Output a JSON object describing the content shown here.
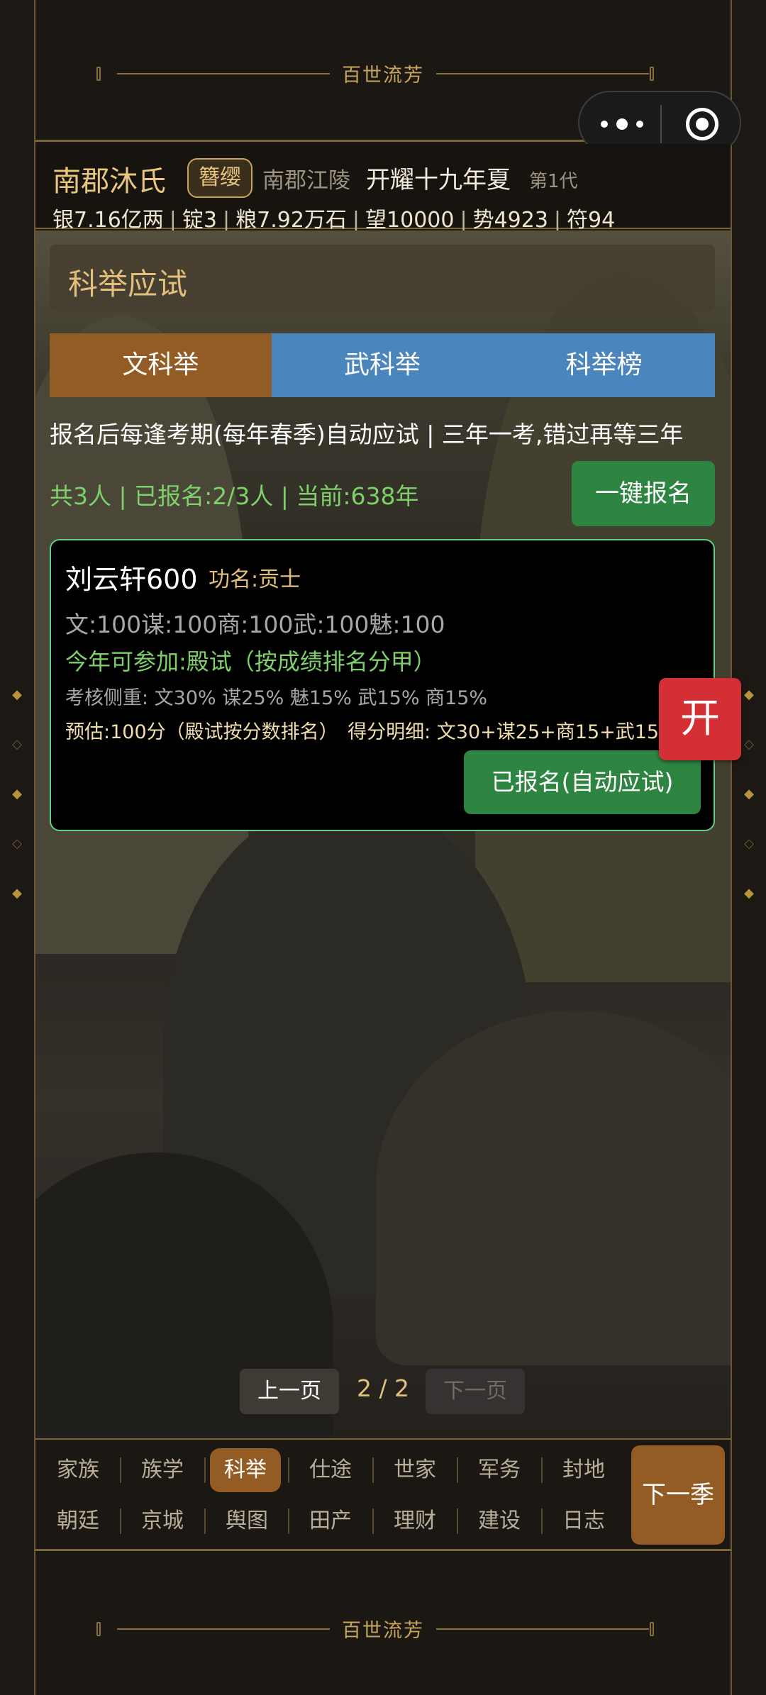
{
  "banner": {
    "title": "百世流芳"
  },
  "capsule": {
    "menu_icon": "more-dots-icon",
    "close_icon": "target-close-icon"
  },
  "header": {
    "clan": "南郡沐氏",
    "rank": "簪缨",
    "region": "南郡江陵",
    "era": "开耀十九年夏",
    "generation": "第1代",
    "resources": [
      "银7.16亿两",
      "锭3",
      "粮7.92万石",
      "望10000",
      "势4923",
      "符94"
    ]
  },
  "page": {
    "section_title": "科举应试"
  },
  "tabs": [
    {
      "label": "文科举",
      "active": true
    },
    {
      "label": "武科举",
      "active": false
    },
    {
      "label": "科举榜",
      "active": false
    }
  ],
  "notice": "报名后每逢考期(每年春季)自动应试 | 三年一考,错过再等三年",
  "summary": "共3人 | 已报名:2/3人 | 当前:638年",
  "quick_register_label": "一键报名",
  "candidate": {
    "name": "刘云轩600",
    "title": "功名:贡士",
    "stats": "文:100谋:100商:100武:100魅:100",
    "eligible": "今年可参加:殿试（按成绩排名分甲）",
    "weights": "考核侧重: 文30% 谋25% 魅15% 武15% 商15%",
    "score": "预估:100分（殿试按分数排名）　得分明细: 文30+谋25+商15+武15+魅15",
    "register_label": "已报名(自动应试)"
  },
  "float_button": "开",
  "pager": {
    "prev": "上一页",
    "current": "2 / 2",
    "next": "下一页"
  },
  "nav": {
    "row1": [
      "家族",
      "族学",
      "科举",
      "仕途",
      "世家",
      "军务",
      "封地"
    ],
    "row2": [
      "朝廷",
      "京城",
      "舆图",
      "田产",
      "理财",
      "建设",
      "日志"
    ],
    "active": "科举",
    "next_season": "下一季"
  },
  "colors": {
    "accent_gold": "#e2c07c",
    "tab_active": "#935c24",
    "tab_inactive": "#4a85bd",
    "green": "#2e8542",
    "red": "#d42f35"
  }
}
